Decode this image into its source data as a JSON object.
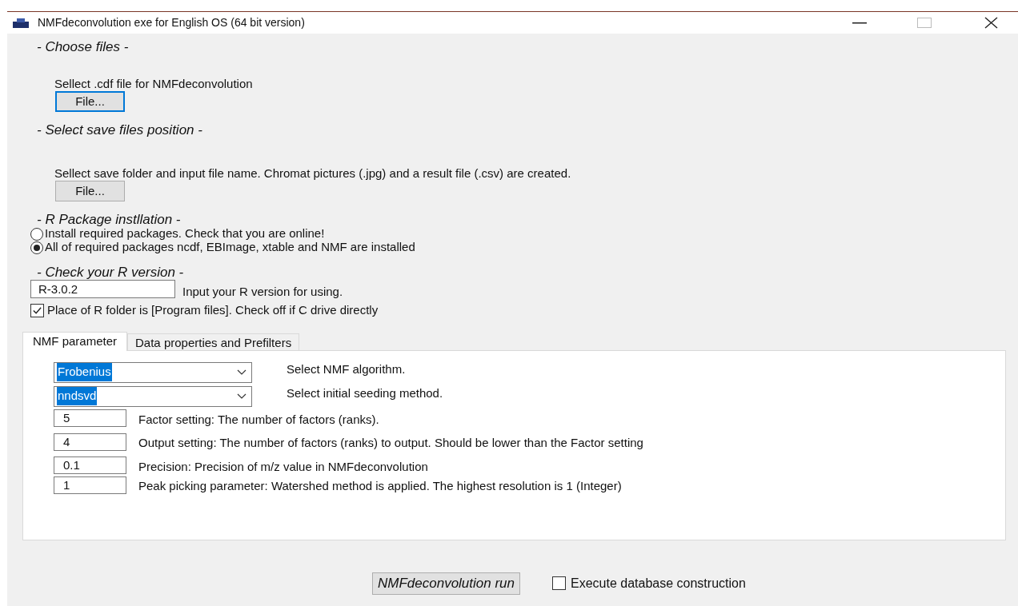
{
  "window": {
    "title": "NMFdeconvolution exe for English OS (64 bit version)"
  },
  "sections": [
    {
      "heading": "- Choose files -",
      "label": "Sellect .cdf file for NMFdeconvolution",
      "button": {
        "label": "File...",
        "focused": true
      }
    },
    {
      "heading": "- Select save files position -",
      "label": "Sellect save folder and input file name.  Chromat pictures (.jpg) and a result file (.csv) are created.",
      "button": {
        "label": "File...",
        "focused": false
      }
    }
  ],
  "packages": {
    "heading": "- R Package instllation -",
    "options": [
      {
        "label": "Install required packages.  Check that you are online!",
        "selected": false
      },
      {
        "label": "All of required packages ncdf, EBImage, xtable and NMF are installed",
        "selected": true
      }
    ]
  },
  "r_version": {
    "heading": "- Check your R version -",
    "value": "R-3.0.2",
    "label": "Input your R version for using.",
    "program_files": {
      "label": "Place of R folder is [Program files]. Check off if C drive directly",
      "checked": true
    }
  },
  "tabs": [
    {
      "label": "NMF parameter",
      "selected": true
    },
    {
      "label": "Data properties and Prefilters",
      "selected": false
    }
  ],
  "params": [
    {
      "kind": "select",
      "value": "Frobenius",
      "highlighted": true,
      "label": "Select NMF algorithm."
    },
    {
      "kind": "select",
      "value": "nndsvd",
      "highlighted": true,
      "label": "Select initial seeding method."
    },
    {
      "kind": "input",
      "value": "5",
      "label": "Factor setting: The number of factors (ranks)."
    },
    {
      "kind": "input",
      "value": "4",
      "label": "Output setting: The number of factors (ranks) to output. Should be lower than the Factor setting"
    },
    {
      "kind": "input",
      "value": "0.1",
      "label": "Precision: Precision of m/z value in NMFdeconvolution"
    },
    {
      "kind": "input",
      "value": "1",
      "label": "Peak picking parameter: Watershed method is applied. The highest resolution is 1 (Integer)"
    }
  ],
  "run_button": "NMFdeconvolution run",
  "database": {
    "label": "Execute database construction",
    "checked": false
  }
}
